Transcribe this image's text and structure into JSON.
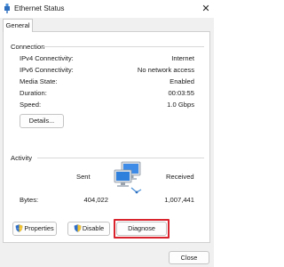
{
  "window": {
    "title": "Ethernet Status",
    "close_glyph": "✕"
  },
  "tabs": [
    {
      "label": "General"
    }
  ],
  "connection": {
    "heading": "Connection",
    "rows": [
      {
        "label": "IPv4 Connectivity:",
        "value": "Internet"
      },
      {
        "label": "IPv6 Connectivity:",
        "value": "No network access"
      },
      {
        "label": "Media State:",
        "value": "Enabled"
      },
      {
        "label": "Duration:",
        "value": "00:03:55"
      },
      {
        "label": "Speed:",
        "value": "1.0 Gbps"
      }
    ],
    "details_label": "Details..."
  },
  "activity": {
    "heading": "Activity",
    "sent_label": "Sent",
    "received_label": "Received",
    "bytes_label": "Bytes:",
    "bytes_sent": "404,022",
    "bytes_received": "1,007,441",
    "icon": "network-computers-icon"
  },
  "buttons": {
    "properties": "Properties",
    "disable": "Disable",
    "diagnose": "Diagnose",
    "close": "Close"
  },
  "icons": {
    "title": "ethernet-plug-icon",
    "properties": "shield-icon",
    "disable": "shield-icon"
  },
  "colors": {
    "highlight": "#d9232d",
    "shield_blue": "#2f6fc8",
    "shield_yellow": "#f2c230"
  }
}
